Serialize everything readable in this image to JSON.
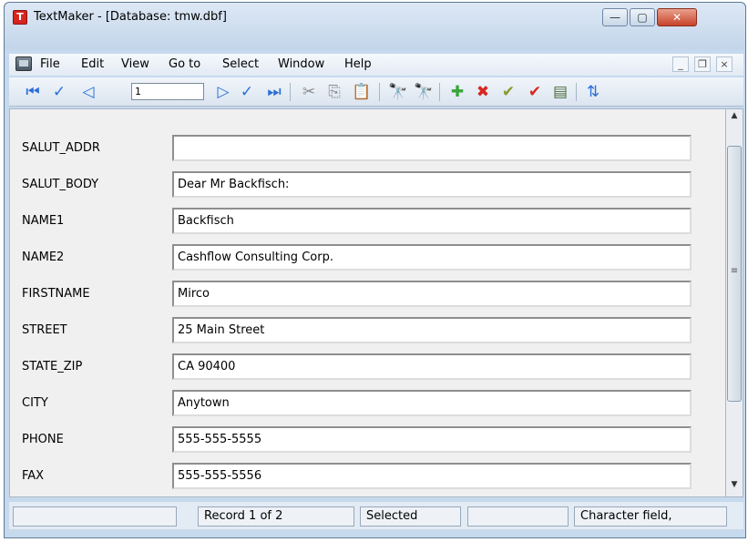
{
  "window": {
    "title": "TextMaker - [Database: tmw.dbf]",
    "app_icon_letter": "T",
    "caption_buttons": {
      "minimize": "—",
      "maximize": "▢",
      "close": "✕"
    }
  },
  "menu": {
    "items": [
      "File",
      "Edit",
      "View",
      "Go to",
      "Select",
      "Window",
      "Help"
    ],
    "mdi_buttons": {
      "minimize": "_",
      "restore": "❐",
      "close": "×"
    }
  },
  "toolbar": {
    "record_number": "1",
    "icons": {
      "first": "⏮",
      "prev_marked": "✓",
      "prev": "◁",
      "next": "▷",
      "next_marked": "✓",
      "last": "⏭",
      "cut": "✂",
      "copy": "⎘",
      "paste": "📋",
      "find": "🔭",
      "find_again": "🔭",
      "add": "✚",
      "delete": "✖",
      "mark": "✔",
      "unmark": "✔",
      "database": "▤",
      "sort": "⇅"
    },
    "colors": {
      "nav": "#2b6fd6",
      "add": "#39a63a",
      "delete": "#d8281f",
      "mark": "#8a9a2a"
    }
  },
  "record": {
    "fields": [
      {
        "label": "SALUT_ADDR",
        "value": ""
      },
      {
        "label": "SALUT_BODY",
        "value": "Dear Mr Backfisch:"
      },
      {
        "label": "NAME1",
        "value": "Backfisch"
      },
      {
        "label": "NAME2",
        "value": "Cashflow Consulting Corp."
      },
      {
        "label": "FIRSTNAME",
        "value": "Mirco"
      },
      {
        "label": "STREET",
        "value": "25 Main Street"
      },
      {
        "label": "STATE_ZIP",
        "value": "CA 90400"
      },
      {
        "label": "CITY",
        "value": "Anytown"
      },
      {
        "label": "PHONE",
        "value": "555-555-5555"
      },
      {
        "label": "FAX",
        "value": "555-555-5556"
      }
    ]
  },
  "scrollbar": {
    "up": "▲",
    "down": "▼",
    "grip": "≡"
  },
  "status": {
    "pane1": "",
    "record_info": "Record 1 of 2",
    "selected": "Selected",
    "pane4": "",
    "field_type": "Character field,"
  }
}
